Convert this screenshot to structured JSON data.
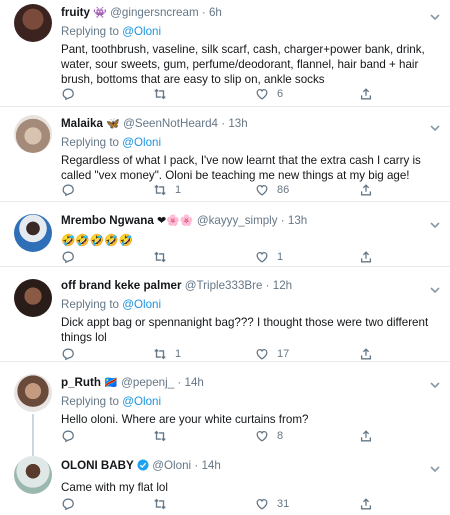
{
  "tweets": [
    {
      "name": "fruity",
      "name_emoji": "👾",
      "handle": "@gingersncream",
      "dot": "·",
      "time": "6h",
      "reply_prefix": "Replying to ",
      "reply_handle": "@Oloni",
      "text": "Pant, toothbrush, vaseline, silk scarf, cash, charger+power bank, drink, water, sour sweets, gum, perfume/deodorant, flannel, hair band + hair brush, bottoms that are easy to slip on, ankle socks",
      "reply_count": "",
      "retweet_count": "",
      "like_count": "6"
    },
    {
      "name": "Malaika",
      "name_emoji": "🦋",
      "handle": "@SeenNotHeard4",
      "dot": "·",
      "time": "13h",
      "reply_prefix": "Replying to ",
      "reply_handle": "@Oloni",
      "text": "Regardless of what I pack, I've now learnt that the extra cash I carry is called \"vex money\". Oloni be teaching me new things at my big age!",
      "reply_count": "",
      "retweet_count": "1",
      "like_count": "86"
    },
    {
      "name": "Mrembo Ngwana",
      "name_emoji": "❤🌸🌸",
      "handle": "@kayyy_simply",
      "dot": "·",
      "time": "13h",
      "reply_prefix": "",
      "reply_handle": "",
      "text": "🤣🤣🤣🤣🤣",
      "reply_count": "",
      "retweet_count": "",
      "like_count": "1"
    },
    {
      "name": "off brand keke palmer",
      "name_emoji": "",
      "handle": "@Triple333Bre",
      "dot": "·",
      "time": "12h",
      "reply_prefix": "Replying to ",
      "reply_handle": "@Oloni",
      "text": "Dick appt bag or spennanight bag??? I thought those were two different things lol",
      "reply_count": "",
      "retweet_count": "1",
      "like_count": "17"
    },
    {
      "name": "p_Ruth",
      "name_emoji": "🇨🇩",
      "handle": "@pepenj_",
      "dot": "·",
      "time": "14h",
      "reply_prefix": "Replying to ",
      "reply_handle": "@Oloni",
      "text": "Hello oloni. Where are your white curtains from?",
      "reply_count": "",
      "retweet_count": "",
      "like_count": "8"
    },
    {
      "name": "OLONI BABY",
      "name_emoji": "",
      "handle": "@Oloni",
      "dot": "·",
      "time": "14h",
      "reply_prefix": "",
      "reply_handle": "",
      "text": "Came with my flat lol",
      "reply_count": "",
      "retweet_count": "",
      "like_count": "31"
    }
  ],
  "colors": {
    "name": "#14171a",
    "meta": "#657786",
    "link": "#1b95e0",
    "divider": "#e6ecf0",
    "verified": "#1da1f2"
  },
  "icons": [
    "reply-icon",
    "retweet-icon",
    "like-icon",
    "share-icon",
    "chevron-down-icon",
    "verified-badge-icon"
  ]
}
